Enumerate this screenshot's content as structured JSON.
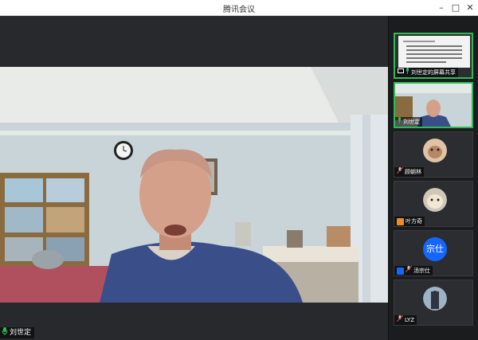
{
  "window": {
    "title": "腾讯会议"
  },
  "main_speaker": {
    "name": "刘世定"
  },
  "participants": [
    {
      "name": "刘世定的屏幕共享"
    },
    {
      "name": "刘世定"
    },
    {
      "name": "顾朝林"
    },
    {
      "name": "叶方奇"
    },
    {
      "name": "汤宗仕",
      "avatar_text": "宗仕"
    },
    {
      "name": "LYZ"
    }
  ],
  "colors": {
    "active_border": "#2dbb57",
    "mic_green": "#2dbb57",
    "avatar_blue": "#1565ff"
  },
  "icons": [
    "minimize-icon",
    "maximize-icon",
    "close-icon",
    "mic-icon",
    "mic-muted-icon",
    "screen-share-icon",
    "host-icon"
  ]
}
